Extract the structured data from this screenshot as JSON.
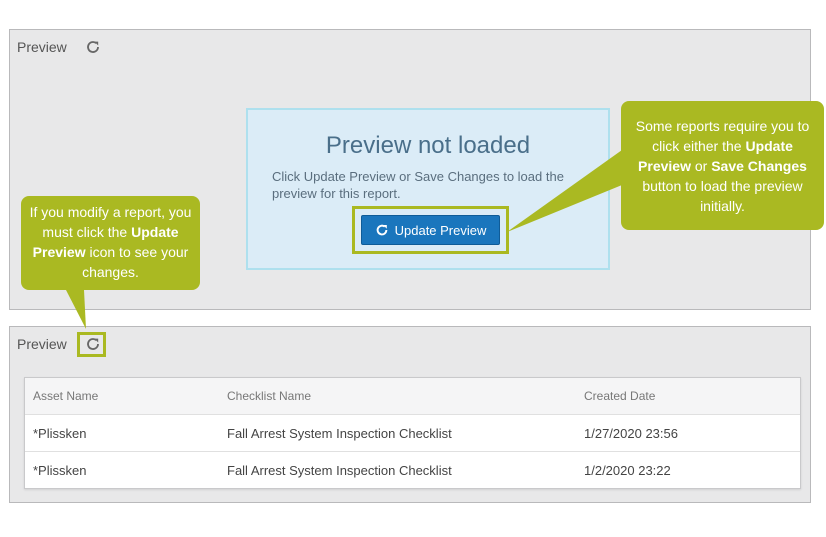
{
  "preview_panel_top": {
    "title": "Preview",
    "refresh_icon": "refresh-icon"
  },
  "not_loaded": {
    "title": "Preview not loaded",
    "description": "Click Update Preview or Save Changes to load the preview for this report.",
    "button_label": "Update Preview"
  },
  "callout_left": {
    "text_before": "If you modify a report, you must click the ",
    "bold": "Update Preview",
    "text_after": " icon to see your changes."
  },
  "callout_right": {
    "text_1": "Some reports require you to click either the ",
    "bold_1": "Update Preview",
    "text_2": " or ",
    "bold_2": "Save Changes",
    "text_3": " button to load the preview initially."
  },
  "preview_panel_bottom": {
    "title": "Preview",
    "table": {
      "headers": [
        "Asset Name",
        "Checklist Name",
        "Created Date"
      ],
      "rows": [
        [
          "*Plissken",
          "Fall Arrest System Inspection Checklist",
          "1/27/2020 23:56"
        ],
        [
          "*Plissken",
          "Fall Arrest System Inspection Checklist",
          "1/2/2020 23:22"
        ]
      ]
    }
  },
  "colors": {
    "callout": "#aab922",
    "button": "#1a76bd",
    "panel": "#e8e8e9",
    "notice_bg": "#dbecf7"
  }
}
